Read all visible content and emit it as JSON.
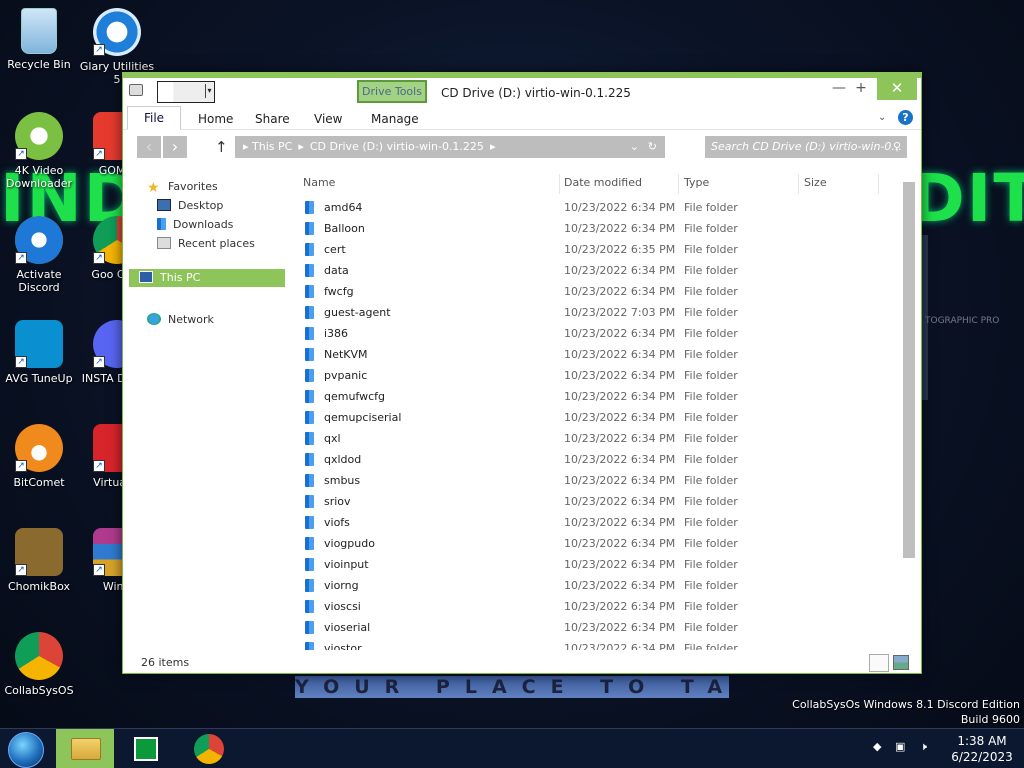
{
  "wallpaper": {
    "left_text": "IND",
    "right_text": "DIT",
    "banner": "YOUR PLACE TO TALK",
    "faint_text": "TOGRAPHIC PRO"
  },
  "desktop_icons": [
    {
      "label": "Recycle Bin"
    },
    {
      "label": "Glary Utilities 5"
    },
    {
      "label": "4K Video Downloader"
    },
    {
      "label": "GOM F"
    },
    {
      "label": "Activate Discord"
    },
    {
      "label": "Goo Chro"
    },
    {
      "label": "AVG TuneUp"
    },
    {
      "label": "INSTA DISCO"
    },
    {
      "label": "BitComet"
    },
    {
      "label": "VirtualDJ"
    },
    {
      "label": "ChomikBox"
    },
    {
      "label": "WinR"
    },
    {
      "label": "CollabSysOS"
    }
  ],
  "watermark": {
    "line1": "CollabSysOs Windows 8.1 Discord Edition",
    "line2": "Build 9600"
  },
  "window": {
    "context_tab": "Drive Tools",
    "title": "CD Drive (D:) virtio-win-0.1.225",
    "controls": {
      "minimize": "—",
      "maximize": "+",
      "close": "✕"
    },
    "ribbon_tabs": [
      "File",
      "Home",
      "Share",
      "View",
      "Manage"
    ],
    "address": {
      "root": "This PC",
      "current": "CD Drive (D:) virtio-win-0.1.225"
    },
    "search_placeholder": "Search CD Drive (D:) virtio-win-0...",
    "nav": {
      "favorites": "Favorites",
      "desktop": "Desktop",
      "downloads": "Downloads",
      "recent": "Recent places",
      "this_pc": "This PC",
      "network": "Network"
    },
    "columns": [
      "Name",
      "Date modified",
      "Type",
      "Size"
    ],
    "files": [
      {
        "name": "amd64",
        "date": "10/23/2022 6:34 PM",
        "type": "File folder"
      },
      {
        "name": "Balloon",
        "date": "10/23/2022 6:34 PM",
        "type": "File folder"
      },
      {
        "name": "cert",
        "date": "10/23/2022 6:35 PM",
        "type": "File folder"
      },
      {
        "name": "data",
        "date": "10/23/2022 6:34 PM",
        "type": "File folder"
      },
      {
        "name": "fwcfg",
        "date": "10/23/2022 6:34 PM",
        "type": "File folder"
      },
      {
        "name": "guest-agent",
        "date": "10/23/2022 7:03 PM",
        "type": "File folder"
      },
      {
        "name": "i386",
        "date": "10/23/2022 6:34 PM",
        "type": "File folder"
      },
      {
        "name": "NetKVM",
        "date": "10/23/2022 6:34 PM",
        "type": "File folder"
      },
      {
        "name": "pvpanic",
        "date": "10/23/2022 6:34 PM",
        "type": "File folder"
      },
      {
        "name": "qemufwcfg",
        "date": "10/23/2022 6:34 PM",
        "type": "File folder"
      },
      {
        "name": "qemupciserial",
        "date": "10/23/2022 6:34 PM",
        "type": "File folder"
      },
      {
        "name": "qxl",
        "date": "10/23/2022 6:34 PM",
        "type": "File folder"
      },
      {
        "name": "qxldod",
        "date": "10/23/2022 6:34 PM",
        "type": "File folder"
      },
      {
        "name": "smbus",
        "date": "10/23/2022 6:34 PM",
        "type": "File folder"
      },
      {
        "name": "sriov",
        "date": "10/23/2022 6:34 PM",
        "type": "File folder"
      },
      {
        "name": "viofs",
        "date": "10/23/2022 6:34 PM",
        "type": "File folder"
      },
      {
        "name": "viogpudo",
        "date": "10/23/2022 6:34 PM",
        "type": "File folder"
      },
      {
        "name": "vioinput",
        "date": "10/23/2022 6:34 PM",
        "type": "File folder"
      },
      {
        "name": "viorng",
        "date": "10/23/2022 6:34 PM",
        "type": "File folder"
      },
      {
        "name": "vioscsi",
        "date": "10/23/2022 6:34 PM",
        "type": "File folder"
      },
      {
        "name": "vioserial",
        "date": "10/23/2022 6:34 PM",
        "type": "File folder"
      },
      {
        "name": "viostor",
        "date": "10/23/2022 6:34 PM",
        "type": "File folder"
      }
    ],
    "status": "26 items"
  },
  "taskbar": {
    "time": "1:38 AM",
    "date": "6/22/2023"
  },
  "colors": {
    "accent": "#8dc55a",
    "address_bg": "#bdbdbd",
    "folder_blue": "#1a6fd0",
    "taskbar_bg": "#0c1830"
  }
}
